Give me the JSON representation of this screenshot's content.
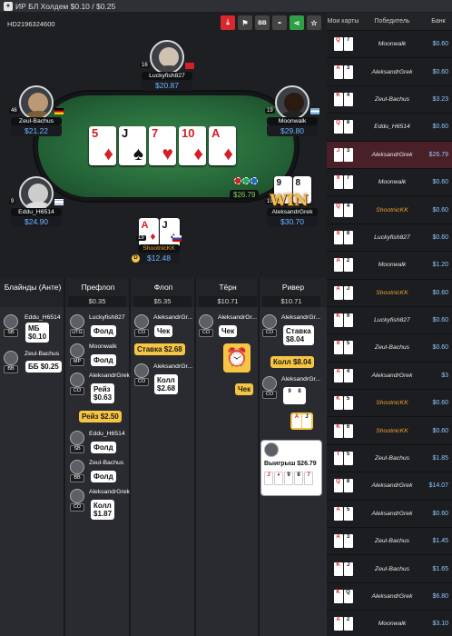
{
  "title": "ИР БЛ Холдем $0.10 / $0.25",
  "hand_id": "HD2196324600",
  "toolbar": {
    "bb_label": "BB"
  },
  "board": [
    {
      "rank": "5",
      "suit": "♦",
      "color": "red"
    },
    {
      "rank": "J",
      "suit": "♠",
      "color": "blk"
    },
    {
      "rank": "7",
      "suit": "♥",
      "color": "red"
    },
    {
      "rank": "10",
      "suit": "♦",
      "color": "red"
    },
    {
      "rank": "A",
      "suit": "♦",
      "color": "red"
    }
  ],
  "seats": {
    "top": {
      "name": "Luckyfish827",
      "stack": "$20.87",
      "level": "16"
    },
    "left_top": {
      "name": "Zeul-Bachus",
      "stack": "$21.22",
      "level": "46"
    },
    "right_top": {
      "name": "Moonwalk",
      "stack": "$29.80",
      "level": "19"
    },
    "left_bottom": {
      "name": "Eddu_H6514",
      "stack": "$24.90",
      "level": "9"
    },
    "right_bottom": {
      "name": "AleksandrGrek",
      "stack": "$30.70",
      "level": "19",
      "cards": [
        "9",
        "8"
      ]
    },
    "hero": {
      "name": "ShootnicKK",
      "stack": "$12.48",
      "level": "19",
      "cards": [
        {
          "rank": "A",
          "suit": "♦",
          "color": "red"
        },
        {
          "rank": "J",
          "suit": "♠",
          "color": "blk"
        }
      ]
    }
  },
  "pot": "$26.79",
  "win_label": "WIN",
  "dealer": "D",
  "history": {
    "columns": [
      {
        "title": "Блайнды (Анте)",
        "pot": ""
      },
      {
        "title": "Префлоп",
        "pot": "$0.35"
      },
      {
        "title": "Флоп",
        "pot": "$5.35"
      },
      {
        "title": "Тёрн",
        "pot": "$10.71"
      },
      {
        "title": "Ривер",
        "pot": "$10.71"
      }
    ],
    "blinds": [
      {
        "name": "Eddu_H6514",
        "pos": "SB",
        "action": "МБ\n$0.10"
      },
      {
        "name": "Zeul-Bachus",
        "pos": "BB",
        "action": "ББ $0.25"
      }
    ],
    "preflop": [
      {
        "name": "Luckyfish827",
        "pos": "UTG",
        "action": "Фолд"
      },
      {
        "name": "Moonwalk",
        "pos": "MP",
        "action": "Фолд"
      },
      {
        "name": "AleksandrGrek",
        "pos": "CO",
        "action": "Рейз\n$0.63"
      },
      {
        "raise": "Рейз $2.50"
      },
      {
        "name": "Eddu_H6514",
        "pos": "SB",
        "action": "Фолд"
      },
      {
        "name": "Zeul-Bachus",
        "pos": "BB",
        "action": "Фолд"
      },
      {
        "name": "AleksandrGrek",
        "pos": "CO",
        "action": "Колл\n$1.87"
      }
    ],
    "flop": [
      {
        "name": "AleksandrGr...",
        "pos": "CO",
        "action": "Чек"
      },
      {
        "bet": "Ставка $2.68"
      },
      {
        "name": "AleksandrGr...",
        "pos": "CO",
        "action": "Колл\n$2.68"
      }
    ],
    "turn": [
      {
        "name": "AleksandrGr...",
        "pos": "CO",
        "action": "Чек"
      },
      {
        "check": "Чек"
      }
    ],
    "river": [
      {
        "name": "AleksandrGr...",
        "pos": "CO",
        "action": "Ставка\n$8.04"
      },
      {
        "call": "Колл $8.04"
      },
      {
        "name": "AleksandrGr...",
        "pos": "CO",
        "cards": [
          "9",
          "8"
        ]
      },
      {
        "hero_cards": [
          "A",
          "J"
        ]
      },
      {
        "win": "Выигрыш $26.79"
      }
    ]
  },
  "right_panel": {
    "headers": [
      "Мои карты",
      "Победитель",
      "Банк"
    ],
    "rows": [
      {
        "c1": "Q",
        "c2": "7",
        "winner": "Moonwalk",
        "bank": "$0.60",
        "or": false,
        "hl": false
      },
      {
        "c1": "A",
        "c2": "3",
        "winner": "AleksandrGrek",
        "bank": "$0.60",
        "or": false,
        "hl": false
      },
      {
        "c1": "K",
        "c2": "4",
        "winner": "Zeul-Bachus",
        "bank": "$3.23",
        "or": false,
        "hl": false
      },
      {
        "c1": "Q",
        "c2": "8",
        "winner": "Eddu_H6514",
        "bank": "$0.60",
        "or": false,
        "hl": false
      },
      {
        "c1": "J",
        "c2": "3",
        "winner": "AleksandrGrek",
        "bank": "$26.79",
        "or": false,
        "hl": true
      },
      {
        "c1": "9",
        "c2": "7",
        "winner": "Moonwalk",
        "bank": "$0.60",
        "or": false,
        "hl": false
      },
      {
        "c1": "Q",
        "c2": "4",
        "winner": "ShootnicKK",
        "bank": "$0.60",
        "or": true,
        "hl": false
      },
      {
        "c1": "8",
        "c2": "8",
        "winner": "Luckyfish827",
        "bank": "$0.60",
        "or": false,
        "hl": false
      },
      {
        "c1": "A",
        "c2": "2",
        "winner": "Moonwalk",
        "bank": "$1.20",
        "or": false,
        "hl": false
      },
      {
        "c1": "A",
        "c2": "J",
        "winner": "ShootnicKK",
        "bank": "$0.60",
        "or": true,
        "hl": false
      },
      {
        "c1": "K",
        "c2": "9",
        "winner": "Luckyfish827",
        "bank": "$0.60",
        "or": false,
        "hl": false
      },
      {
        "c1": "8",
        "c2": "5",
        "winner": "Zeul-Bachus",
        "bank": "$0.60",
        "or": false,
        "hl": false
      },
      {
        "c1": "A",
        "c2": "4",
        "winner": "AleksandrGrek",
        "bank": "$3",
        "or": false,
        "hl": false
      },
      {
        "c1": "K",
        "c2": "5",
        "winner": "ShootnicKK",
        "bank": "$0.60",
        "or": true,
        "hl": false
      },
      {
        "c1": "K",
        "c2": "6",
        "winner": "ShootnicKK",
        "bank": "$0.60",
        "or": true,
        "hl": false
      },
      {
        "c1": "T",
        "c2": "5",
        "winner": "Zeul-Bachus",
        "bank": "$1.85",
        "or": false,
        "hl": false
      },
      {
        "c1": "Q",
        "c2": "8",
        "winner": "AleksandrGrek",
        "bank": "$14.07",
        "or": false,
        "hl": false
      },
      {
        "c1": "A",
        "c2": "5",
        "winner": "AleksandrGrek",
        "bank": "$0.60",
        "or": false,
        "hl": false
      },
      {
        "c1": "A",
        "c2": "3",
        "winner": "Zeul-Bachus",
        "bank": "$1.45",
        "or": false,
        "hl": false
      },
      {
        "c1": "K",
        "c2": "J",
        "winner": "Zeul-Bachus",
        "bank": "$1.65",
        "or": false,
        "hl": false
      },
      {
        "c1": "K",
        "c2": "Q",
        "winner": "AleksandrGrek",
        "bank": "$6.80",
        "or": false,
        "hl": false
      },
      {
        "c1": "A",
        "c2": "2",
        "winner": "Moonwalk",
        "bank": "$3.10",
        "or": false,
        "hl": false
      }
    ]
  }
}
